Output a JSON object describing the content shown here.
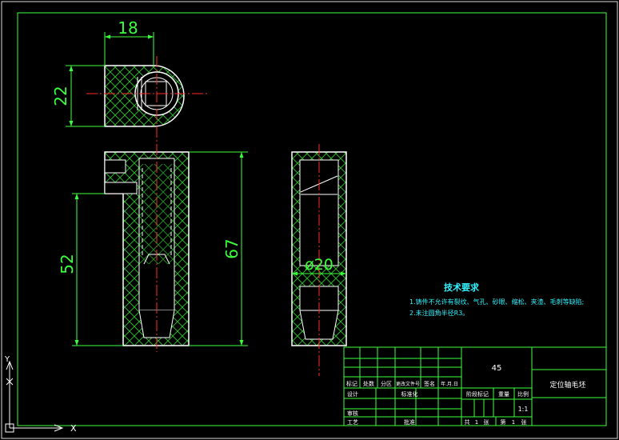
{
  "dimensions": {
    "top_width": "18",
    "top_height": "22",
    "front_height_52": "52",
    "front_height_67": "67",
    "side_diameter": "ø20"
  },
  "notes": {
    "title": "技术要求",
    "line1": "1.铸件不允许有裂纹、气孔、砂眼、缩松、夹渣、毛刺等缺陷;",
    "line2": "2.未注圆角半径R3。"
  },
  "title_block": {
    "material": "45",
    "part_name": "定位轴毛坯",
    "scale": "1:1",
    "row_labels": [
      "标记",
      "处数",
      "分区",
      "更改文件号",
      "签名",
      "年.月.日"
    ],
    "designer_label": "设计",
    "standardization_label": "标准化",
    "review_label": "审核",
    "process_label": "工艺",
    "approve_label": "批准",
    "stage_label": "阶段标记",
    "weight_label": "重量",
    "scale_label": "比例",
    "total_sheets_label": "共",
    "total_sheets_value": "1",
    "sheets_unit_1": "张",
    "sheet_no_label": "第",
    "sheet_no_value": "1",
    "sheets_unit_2": "张"
  },
  "ucs": {
    "x_label": "X",
    "y_label": "Y"
  },
  "colors": {
    "outline": "#ffffff",
    "hatch": "#2fae2f",
    "dimension": "#3cff3c",
    "centerline": "#ff2a2a",
    "notes": "#2ff4ff",
    "table": "#3cff3c"
  }
}
